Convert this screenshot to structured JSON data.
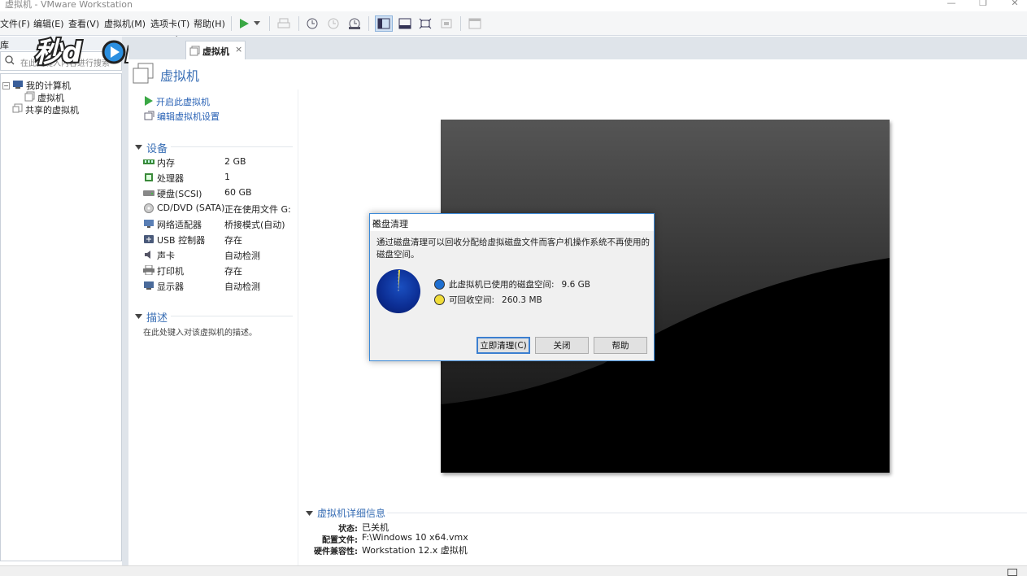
{
  "window": {
    "title": "虚拟机 - VMware Workstation",
    "min": "—",
    "max": "❐",
    "close": "✕"
  },
  "menu": [
    "文件(F)",
    "编辑(E)",
    "查看(V)",
    "虚拟机(M)",
    "选项卡(T)",
    "帮助(H)"
  ],
  "logo_text": "秒懂视频",
  "library": {
    "header": "库",
    "search_placeholder": "在此处键入内容进行搜索",
    "tree": {
      "my_computer": "我的计算机",
      "vm": "虚拟机",
      "shared": "共享的虚拟机"
    }
  },
  "tab": {
    "label": "虚拟机",
    "close": "×"
  },
  "vm": {
    "title": "虚拟机",
    "actions": [
      "开启此虚拟机",
      "编辑虚拟机设置"
    ],
    "devices_heading": "设备",
    "devices": [
      {
        "name": "内存",
        "value": "2 GB"
      },
      {
        "name": "处理器",
        "value": "1"
      },
      {
        "name": "硬盘(SCSI)",
        "value": "60 GB"
      },
      {
        "name": "CD/DVD (SATA)",
        "value": "正在使用文件 G:..."
      },
      {
        "name": "网络适配器",
        "value": "桥接模式(自动)"
      },
      {
        "name": "USB 控制器",
        "value": "存在"
      },
      {
        "name": "声卡",
        "value": "自动检测"
      },
      {
        "name": "打印机",
        "value": "存在"
      },
      {
        "name": "显示器",
        "value": "自动检测"
      }
    ],
    "desc_heading": "描述",
    "desc_placeholder": "在此处键入对该虚拟机的描述。"
  },
  "details": {
    "heading": "虚拟机详细信息",
    "rows": [
      {
        "key": "状态:",
        "value": "已关机"
      },
      {
        "key": "配置文件:",
        "value": "F:\\Windows 10 x64.vmx"
      },
      {
        "key": "硬件兼容性:",
        "value": "Workstation 12.x 虚拟机"
      }
    ]
  },
  "dialog": {
    "title": "磁盘清理",
    "close": "✕",
    "message": "通过磁盘清理可以回收分配给虚拟磁盘文件而客户机操作系统不再使用的磁盘空间。",
    "legend": [
      {
        "label": "此虚拟机已使用的磁盘空间:",
        "value": "9.6 GB",
        "color": "#1f6fd0"
      },
      {
        "label": "可回收空间:",
        "value": "260.3 MB",
        "color": "#f1dd3a"
      }
    ],
    "buttons": {
      "clean": "立即清理(C)",
      "close": "关闭",
      "help": "帮助"
    }
  },
  "colors": {
    "accent": "#3a6fb5",
    "link": "#2962b5",
    "dialog_border": "#3c8ad8",
    "play": "#3aa845"
  }
}
